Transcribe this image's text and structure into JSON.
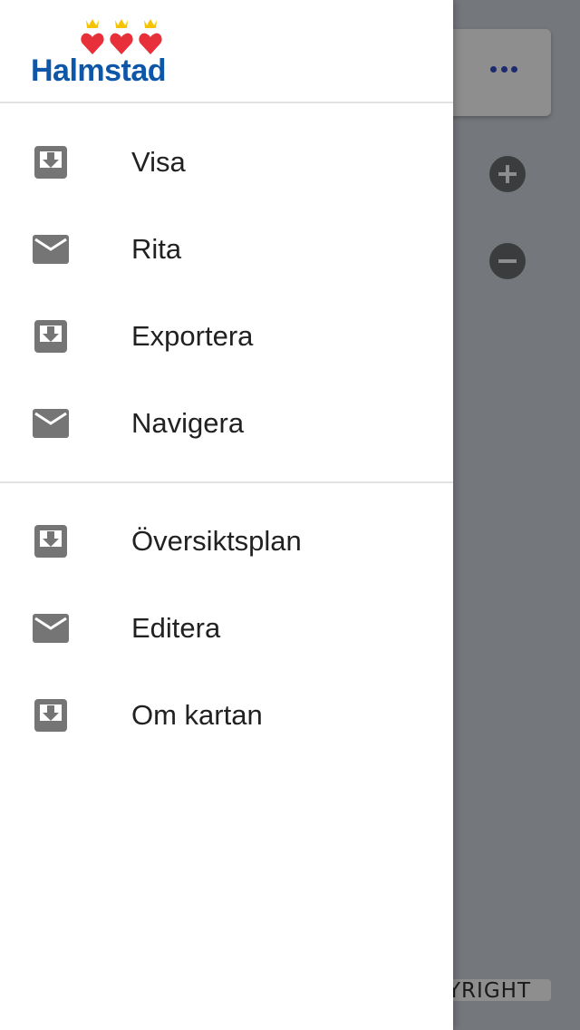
{
  "logo": {
    "text": "Halmstad",
    "colors": {
      "crown": "#f5c400",
      "heart": "#e8303a",
      "word": "#0e56a8"
    }
  },
  "menu": {
    "primary": [
      {
        "label": "Visa",
        "icon": "download-box-icon"
      },
      {
        "label": "Rita",
        "icon": "mail-icon"
      },
      {
        "label": "Exportera",
        "icon": "download-box-icon"
      },
      {
        "label": "Navigera",
        "icon": "mail-icon"
      }
    ],
    "secondary": [
      {
        "label": "Översiktsplan",
        "icon": "download-box-icon"
      },
      {
        "label": "Editera",
        "icon": "mail-icon"
      },
      {
        "label": "Om kartan",
        "icon": "download-box-icon"
      }
    ]
  },
  "background": {
    "copyright_label": "COPYRIGHT",
    "more_icon": "more-horizontal-icon",
    "zoom_in_icon": "plus-icon",
    "zoom_out_icon": "minus-icon"
  },
  "colors": {
    "scrim": "#74777c",
    "icon_gray": "#757575",
    "text": "#212121"
  }
}
